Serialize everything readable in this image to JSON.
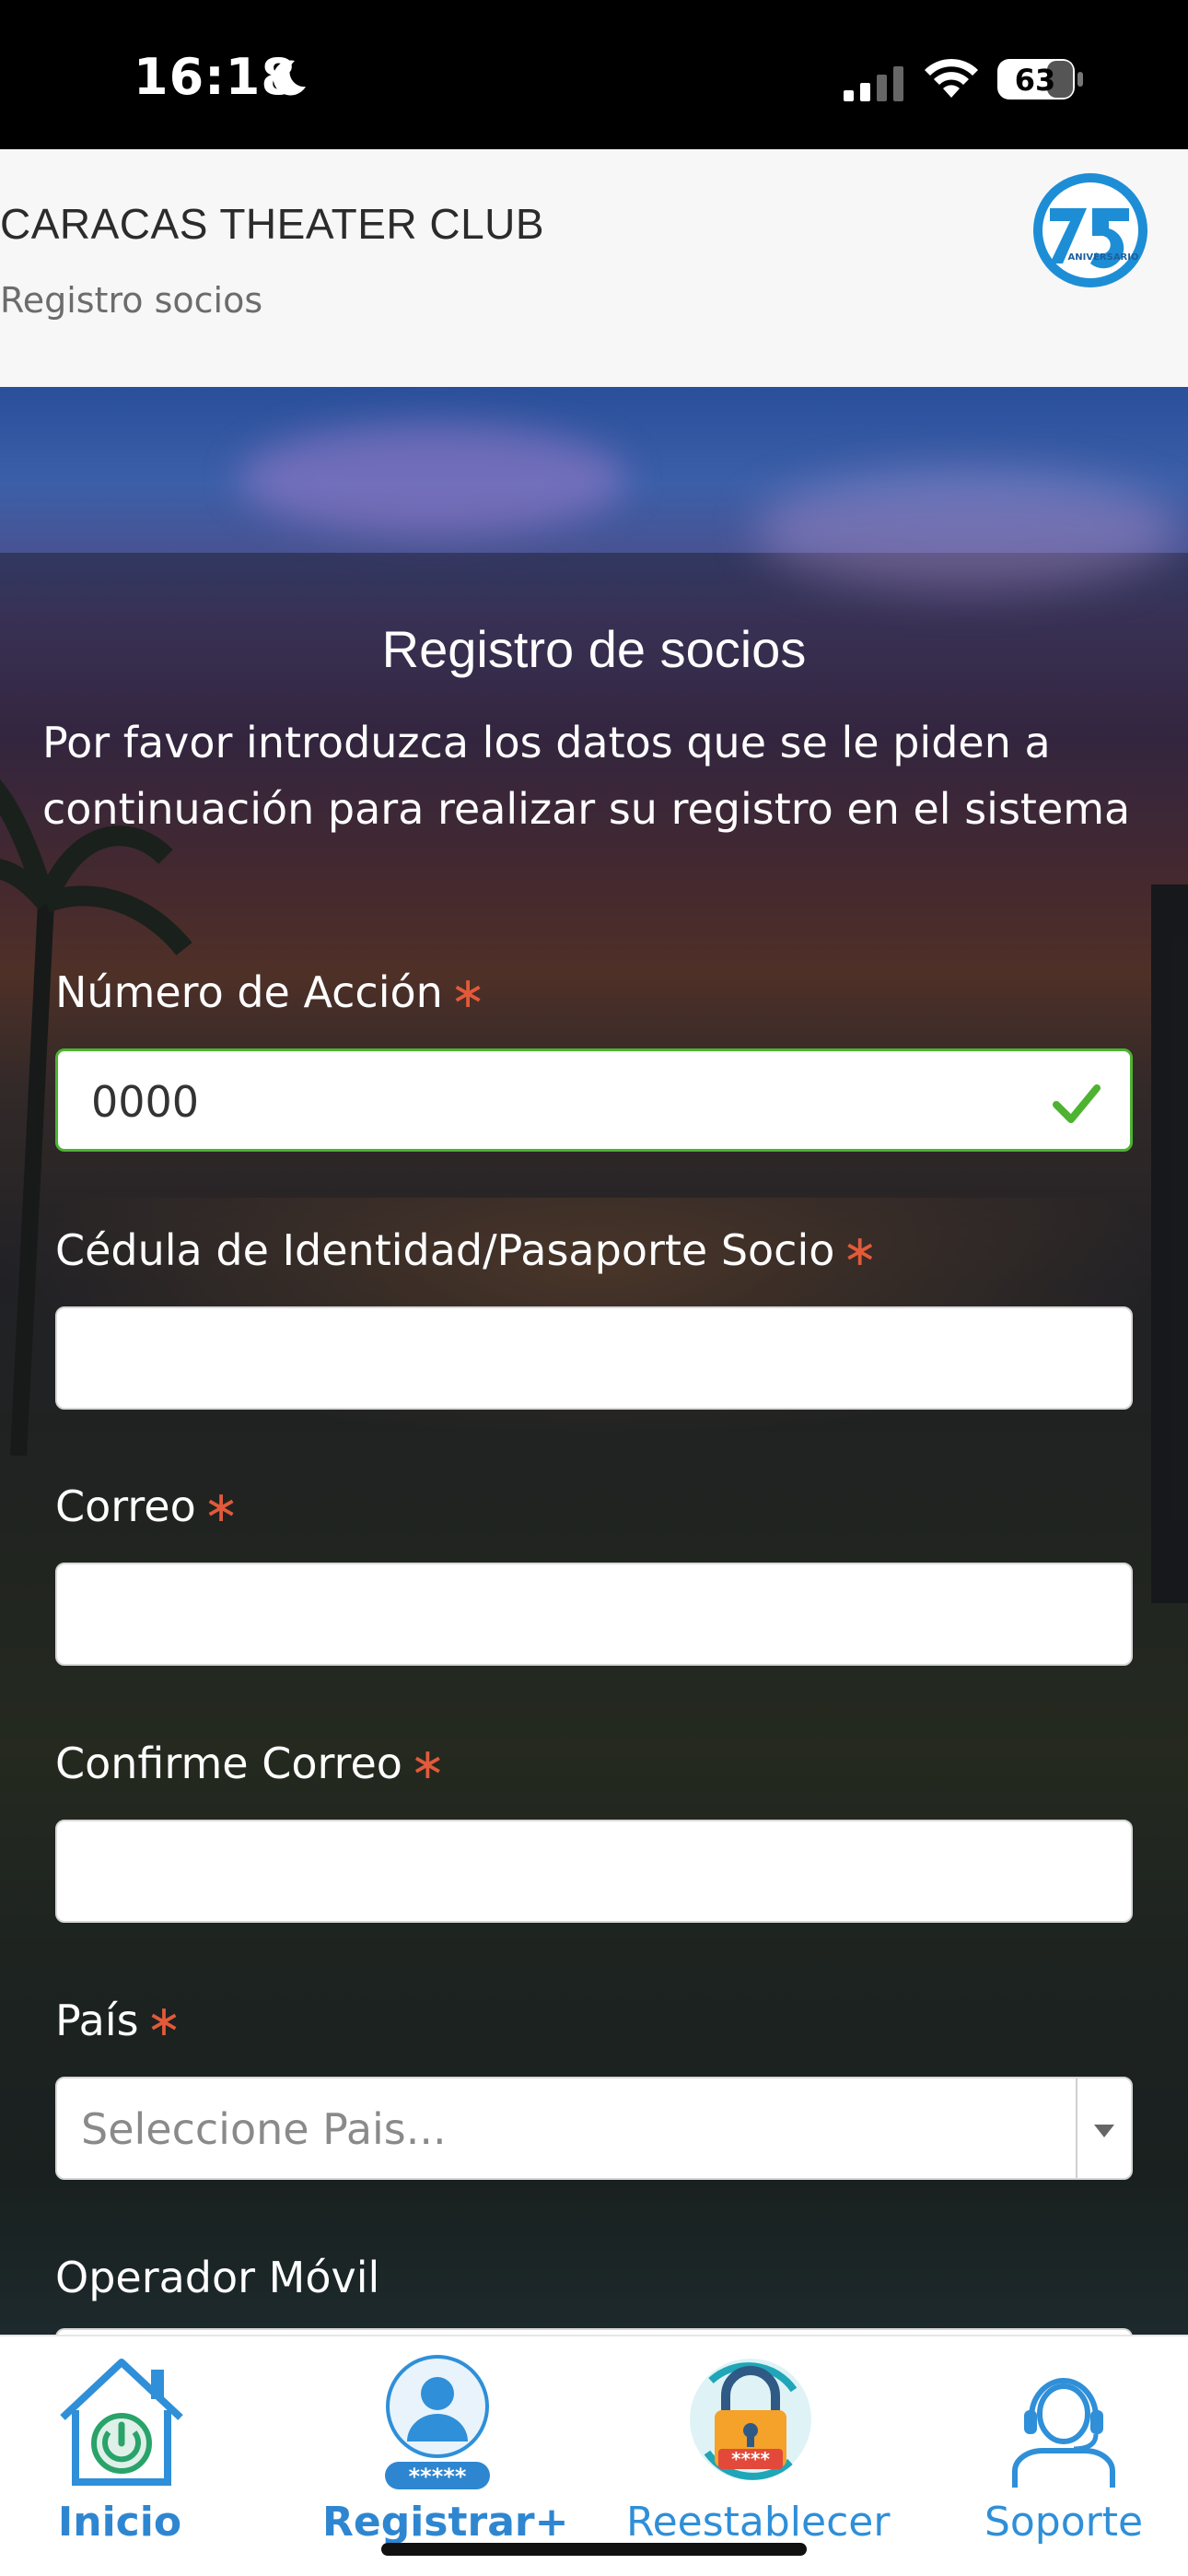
{
  "status_bar": {
    "time": "16:18",
    "battery": "63",
    "icons": [
      "moon-icon",
      "signal-icon",
      "wifi-icon",
      "battery-icon"
    ]
  },
  "header": {
    "club_name": "CARACAS THEATER CLUB",
    "subtitle": "Registro socios",
    "logo_text": "ANIVERSARIO"
  },
  "form": {
    "title": "Registro de socios",
    "intro": "Por favor introduzca los datos que se le piden a continuación para realizar su registro en el sistema",
    "required_mark": "∗",
    "fields": {
      "accion": {
        "label": "Número de Acción",
        "value": "0000"
      },
      "cedula": {
        "label": "Cédula de Identidad/Pasaporte Socio",
        "value": ""
      },
      "correo": {
        "label": "Correo",
        "value": ""
      },
      "confirme_correo": {
        "label": "Confirme Correo",
        "value": ""
      },
      "pais": {
        "label": "País",
        "placeholder": "Seleccione Pais..."
      },
      "operador": {
        "label": "Operador Móvil"
      }
    }
  },
  "bottom_nav": {
    "items": [
      {
        "label": "Inicio",
        "icon": "home-power-icon"
      },
      {
        "label": "Registrar+",
        "icon": "user-register-icon",
        "active": true
      },
      {
        "label": "Reestablecer",
        "icon": "padlock-reset-icon"
      },
      {
        "label": "Soporte",
        "icon": "support-agent-icon"
      }
    ]
  },
  "colors": {
    "accent": "#2f8fd8",
    "required": "#e25a3a",
    "valid": "#4db331"
  }
}
